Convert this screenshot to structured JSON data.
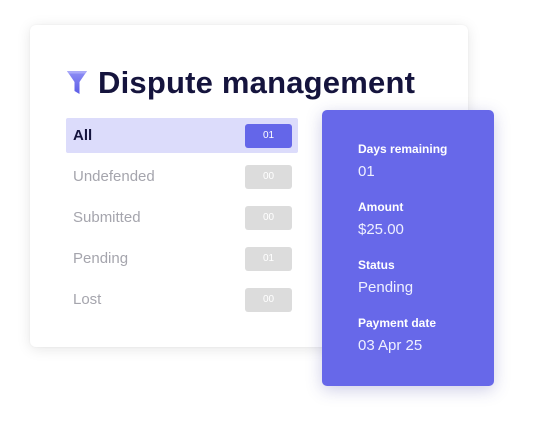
{
  "card": {
    "title": "Dispute management",
    "title_icon": "funnel-icon",
    "filters": [
      {
        "label": "All",
        "count": "01",
        "active": true
      },
      {
        "label": "Undefended",
        "count": "00",
        "active": false
      },
      {
        "label": "Submitted",
        "count": "00",
        "active": false
      },
      {
        "label": "Pending",
        "count": "01",
        "active": false
      },
      {
        "label": "Lost",
        "count": "00",
        "active": false
      }
    ]
  },
  "detail": {
    "fields": [
      {
        "label": "Days remaining",
        "value": "01"
      },
      {
        "label": "Amount",
        "value": "$25.00"
      },
      {
        "label": "Status",
        "value": "Pending"
      },
      {
        "label": "Payment date",
        "value": "03 Apr 25"
      }
    ]
  },
  "colors": {
    "accent": "#6768e9",
    "active_row_bg": "#dcdcfb",
    "title_text": "#15143d",
    "inactive_text": "#a5a5ad",
    "inactive_badge": "#dcdcdc"
  }
}
